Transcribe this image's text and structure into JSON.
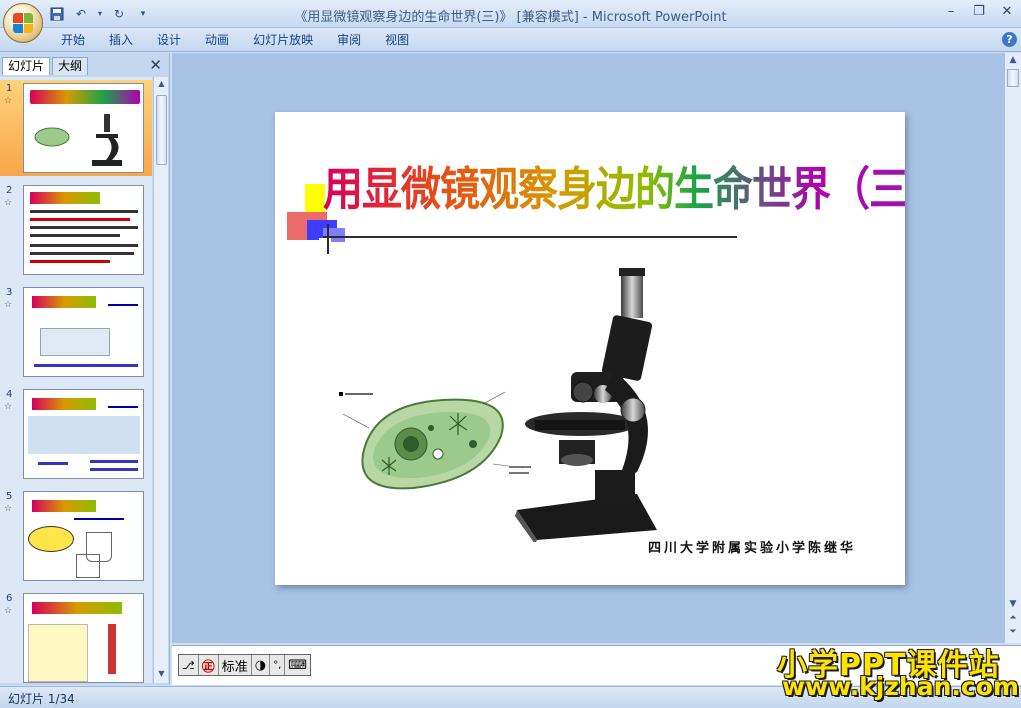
{
  "window": {
    "title": "《用显微镜观察身边的生命世界(三)》 [兼容模式] - Microsoft PowerPoint"
  },
  "ribbon": {
    "tabs": [
      "开始",
      "插入",
      "设计",
      "动画",
      "幻灯片放映",
      "审阅",
      "视图"
    ]
  },
  "left_pane": {
    "tab_slides": "幻灯片",
    "tab_outline": "大纲",
    "slides": [
      {
        "number": "1",
        "selected": true
      },
      {
        "number": "2",
        "selected": false
      },
      {
        "number": "3",
        "selected": false
      },
      {
        "number": "4",
        "selected": false
      },
      {
        "number": "5",
        "selected": false
      },
      {
        "number": "6",
        "selected": false
      }
    ]
  },
  "slide": {
    "title": "用显微镜观察身边的生命世界（三）",
    "author": "四川大学附属实验小学陈继华"
  },
  "ime_toolbar": {
    "mode_label": "标准"
  },
  "status_bar": {
    "slide_counter": "幻灯片 1/34"
  },
  "watermark": {
    "line1": "小学PPT课件站",
    "line2": "www.kjzhan.com"
  }
}
